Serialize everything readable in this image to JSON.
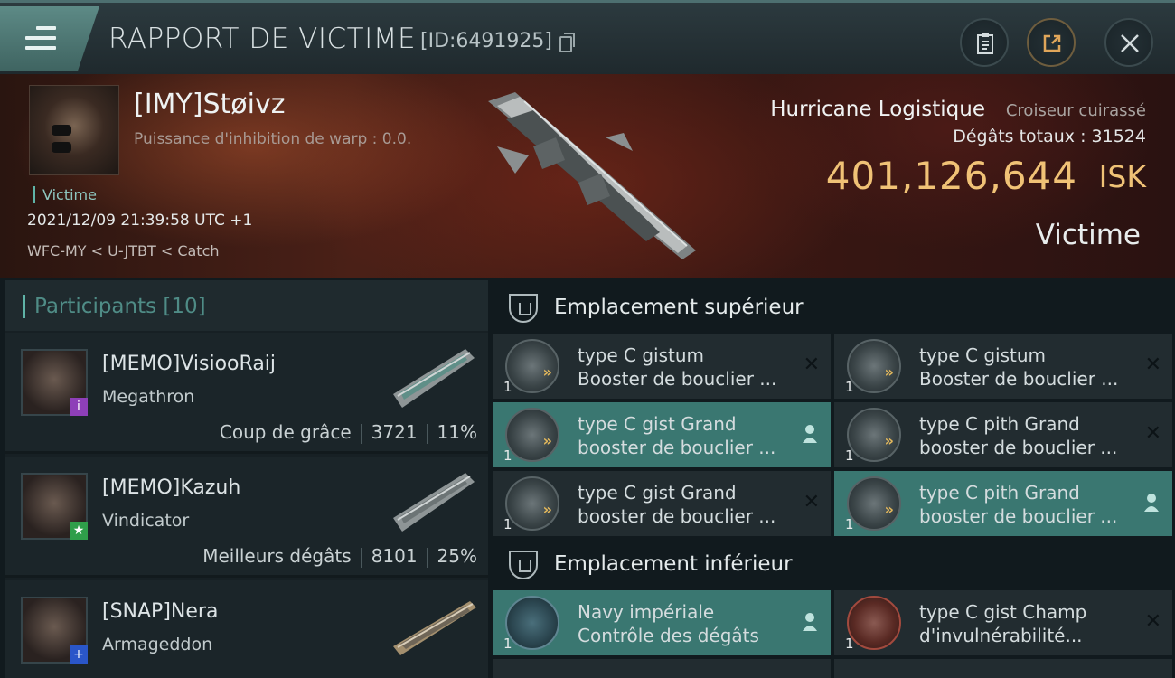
{
  "header": {
    "title": "RAPPORT DE VICTIME",
    "report_id": "[ID:6491925]",
    "icons": [
      "menu-icon",
      "copy-icon",
      "clipboard-icon",
      "share-icon",
      "close-icon"
    ]
  },
  "victim": {
    "name": "[IMY]Støivz",
    "warp_inhibition": "Puissance d'inhibition de warp : 0.0.",
    "role_tag": "Victime",
    "datetime": "2021/12/09 21:39:58 UTC +1",
    "location": "WFC-MY < U-JTBT < Catch",
    "ship_name": "Hurricane Logistique",
    "ship_class": "Croiseur cuirassé",
    "damage_label": "Dégâts totaux :",
    "damage_value": "31524",
    "isk_value": "401,126,644",
    "isk_unit": "ISK",
    "status": "Victime"
  },
  "participants": {
    "title": "Participants",
    "count": "[10]",
    "rows": [
      {
        "name": "[MEMO]VisiooRaij",
        "ship": "Megathron",
        "stat_label": "Coup de grâce",
        "damage": "3721",
        "percent": "11%",
        "badge": "i",
        "badge_color": "#8e3fb8"
      },
      {
        "name": "[MEMO]Kazuh",
        "ship": "Vindicator",
        "stat_label": "Meilleurs dégâts",
        "damage": "8101",
        "percent": "25%",
        "badge": "★",
        "badge_color": "#2f9e4a"
      },
      {
        "name": "[SNAP]Nera",
        "ship": "Armageddon",
        "stat_label": "",
        "damage": "",
        "percent": "",
        "badge": "+",
        "badge_color": "#2a56c9"
      }
    ]
  },
  "slots": {
    "high": {
      "title": "Emplacement supérieur",
      "modules": [
        {
          "line1": "type C gistum",
          "line2": "Booster de bouclier ...",
          "qty": "1",
          "active": false,
          "action": "close-icon",
          "style": "shield"
        },
        {
          "line1": "type C gistum",
          "line2": "Booster de bouclier ...",
          "qty": "1",
          "active": false,
          "action": "close-icon",
          "style": "shield"
        },
        {
          "line1": "type C gist Grand",
          "line2": "booster de bouclier ...",
          "qty": "1",
          "active": true,
          "action": "pilot-icon",
          "style": "shield"
        },
        {
          "line1": "type C pith Grand",
          "line2": "booster de bouclier ...",
          "qty": "1",
          "active": false,
          "action": "close-icon",
          "style": "shield"
        },
        {
          "line1": "type C gist Grand",
          "line2": "booster de bouclier ...",
          "qty": "1",
          "active": false,
          "action": "close-icon",
          "style": "shield"
        },
        {
          "line1": "type C pith Grand",
          "line2": "booster de bouclier ...",
          "qty": "1",
          "active": true,
          "action": "pilot-icon",
          "style": "shield"
        }
      ]
    },
    "low": {
      "title": "Emplacement inférieur",
      "modules": [
        {
          "line1": "Navy impériale",
          "line2": "Contrôle des dégâts",
          "qty": "1",
          "active": true,
          "action": "pilot-icon",
          "style": "navy"
        },
        {
          "line1": "type C gist Champ",
          "line2": "d'invulnérabilité...",
          "qty": "1",
          "active": false,
          "action": "close-icon",
          "style": "red"
        }
      ]
    }
  }
}
